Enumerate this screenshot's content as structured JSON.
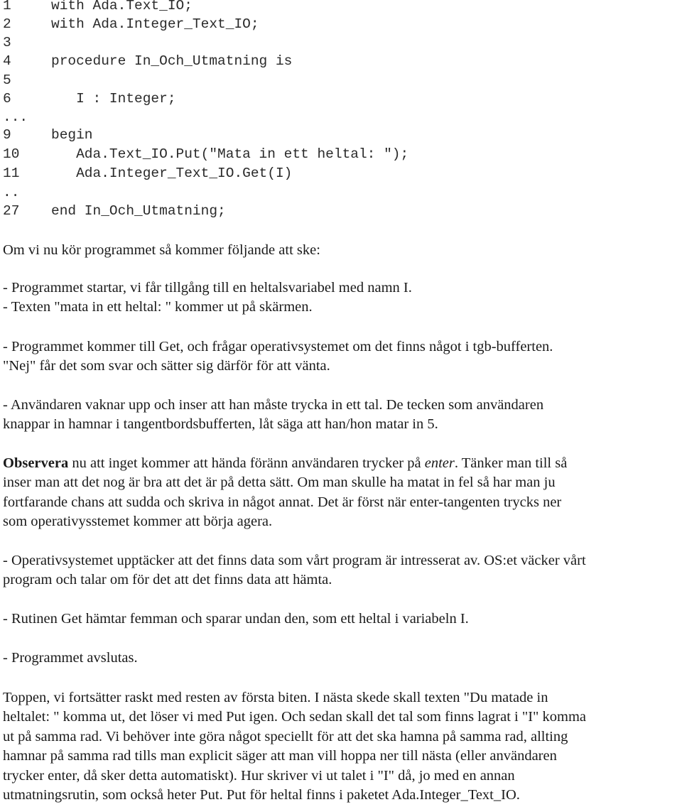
{
  "code": {
    "lines": [
      {
        "num": "1",
        "text": "with Ada.Text_IO;"
      },
      {
        "num": "2",
        "text": "with Ada.Integer_Text_IO;"
      },
      {
        "num": "3",
        "text": ""
      },
      {
        "num": "4",
        "text": "procedure In_Och_Utmatning is"
      },
      {
        "num": "5",
        "text": ""
      },
      {
        "num": "6",
        "text": "   I : Integer;"
      },
      {
        "num": "...",
        "text": ""
      },
      {
        "num": "9",
        "text": "begin"
      },
      {
        "num": "10",
        "text": "   Ada.Text_IO.Put(\"Mata in ett heltal: \");"
      },
      {
        "num": "11",
        "text": "   Ada.Integer_Text_IO.Get(I)"
      },
      {
        "num": "..",
        "text": ""
      },
      {
        "num": "27",
        "text": "end In_Och_Utmatning;"
      }
    ]
  },
  "prose": {
    "intro": "Om vi nu kör programmet så kommer följande att ske:",
    "step1_line1": "- Programmet startar, vi får tillgång till en heltalsvariabel med namn I.",
    "step1_line2": "- Texten \"mata in ett heltal: \" kommer ut på skärmen.",
    "step2_line1": "- Programmet kommer till Get, och frågar operativsystemet om det finns något i   tgb-bufferten.",
    "step2_line2": "\"Nej\" får det som svar och sätter sig därför för att vänta.",
    "step3_line1": "- Användaren vaknar upp och inser att han måste trycka in ett tal.  De tecken som användaren",
    "step3_line2": "knappar in hamnar i tangentbordsbufferten, låt säga att han/hon matar in 5.",
    "observe": {
      "bold": "Observera",
      "line1_a": " nu att inget kommer att hända föränn användaren trycker på ",
      "italic": "enter",
      "line1_b": ". Tänker man till så",
      "line2": "inser man att det nog är bra att det är på detta sätt. Om man skulle ha matat in fel så har man ju",
      "line3": "fortfarande chans att sudda och skriva in något annat. Det är först när enter-tangenten trycks ner",
      "line4": "som operativysstemet kommer att börja agera."
    },
    "step4_line1": "- Operativsystemet upptäcker att det finns data som vårt program är intresserat av. OS:et väcker vårt",
    "step4_line2": "program och talar om för det att det finns data att hämta.",
    "step5": "- Rutinen Get hämtar femman och sparar undan den, som ett heltal i variabeln I.",
    "step6": "- Programmet avslutas.",
    "final": [
      "Toppen, vi fortsätter raskt med resten av första biten. I nästa skede skall texten \"Du matade in",
      "heltalet: \" komma ut, det löser vi med Put igen. Och sedan skall det tal som finns lagrat i \"I\" komma",
      "ut på samma rad. Vi behöver inte göra något speciellt för att det ska hamna på samma rad, allting",
      "hamnar på samma rad tills man explicit säger att man vill hoppa ner till nästa (eller användaren",
      "trycker enter, då sker detta automatiskt). Hur skriver vi ut talet i \"I\" då, jo med en annan",
      "utmatningsrutin, som också heter Put. Put för heltal finns i paketet Ada.Integer_Text_IO."
    ]
  }
}
